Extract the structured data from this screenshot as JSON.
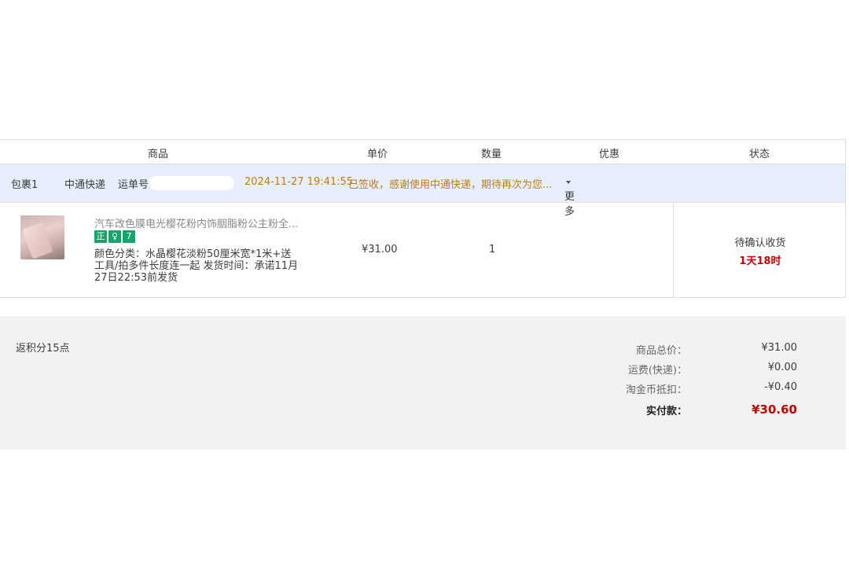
{
  "header": {
    "product": "商品",
    "unit_price": "单价",
    "quantity": "数量",
    "discount": "优惠",
    "status": "状态"
  },
  "package": {
    "label": "包裹1",
    "carrier": "中通快递",
    "tracking_label": "运单号",
    "datetime": "2024-11-27 19:41:55",
    "message": "已签收，感谢使用中通快递，期待再次为您...",
    "more": "更多"
  },
  "item": {
    "title": "汽车改色膜电光樱花粉内饰胭脂粉公主粉全...",
    "badges": [
      "正",
      "♀",
      "7"
    ],
    "sku_prefix": "颜色分类：",
    "sku_value": "水晶樱花淡粉50厘米宽*1米+送工具/拍多件长度连一起",
    "ship_label": "发货时间：",
    "ship_value": "承诺11月27日22:53前发货",
    "price": "¥31.00",
    "quantity": "1",
    "status": "待确认收货",
    "countdown": "1天18时"
  },
  "summary": {
    "points": "返积分15点",
    "goods_total_label": "商品总价：",
    "goods_total": "¥31.00",
    "shipping_label": "运费(快递)：",
    "shipping": "¥0.00",
    "coin_label": "淘金币抵扣：",
    "coin": "-¥0.40",
    "paid_label": "实付款：",
    "paid": "¥30.60"
  }
}
